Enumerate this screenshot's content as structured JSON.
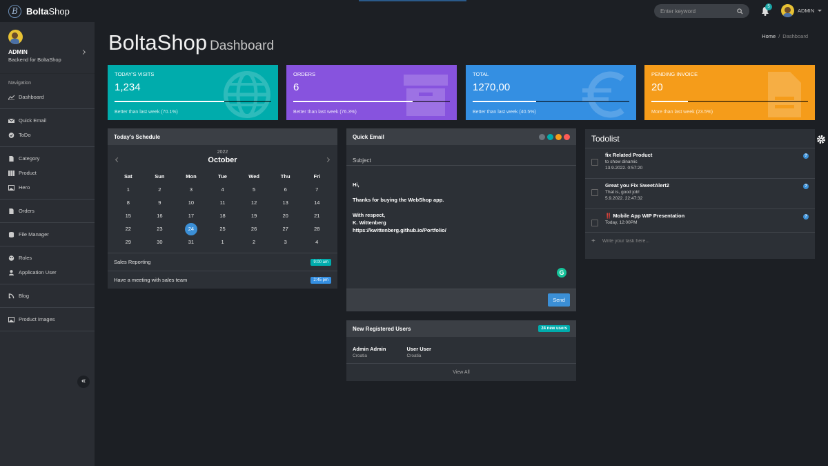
{
  "brand": {
    "name_bold": "Bolta",
    "name_rest": "Shop",
    "logo_letter": "B"
  },
  "search": {
    "placeholder": "Enter keyword"
  },
  "notifications": {
    "count": "5"
  },
  "user": {
    "name": "ADMIN"
  },
  "sidebar": {
    "profile": {
      "name": "ADMIN",
      "subtitle": "Backend for BoltaShop"
    },
    "section_label": "Navigation",
    "items": [
      {
        "label": "Dashboard",
        "icon": "chart-icon"
      },
      {
        "label": "Quick Email",
        "icon": "envelope-icon"
      },
      {
        "label": "ToDo",
        "icon": "check-circle-icon"
      },
      {
        "label": "Category",
        "icon": "file-icon"
      },
      {
        "label": "Product",
        "icon": "columns-icon"
      },
      {
        "label": "Hero",
        "icon": "image-icon"
      },
      {
        "label": "Orders",
        "icon": "file-icon"
      },
      {
        "label": "File Manager",
        "icon": "database-icon"
      },
      {
        "label": "Roles",
        "icon": "roles-icon"
      },
      {
        "label": "Application User",
        "icon": "user-icon"
      },
      {
        "label": "Blog",
        "icon": "blog-icon"
      },
      {
        "label": "Product Images",
        "icon": "image-icon"
      }
    ]
  },
  "page": {
    "title": "BoltaShop",
    "subtitle": "Dashboard"
  },
  "breadcrumb": {
    "home": "Home",
    "separator": "/",
    "current": "Dashboard"
  },
  "stats": [
    {
      "label": "TODAY'S VISITS",
      "value": "1,234",
      "desc": "Better than last week (70.1%)",
      "progress": 70.1,
      "color": "#00acac",
      "icon": "globe-icon"
    },
    {
      "label": "ORDERS",
      "value": "6",
      "desc": "Better than last week (76.3%)",
      "progress": 76.3,
      "color": "#8753de",
      "icon": "archive-icon"
    },
    {
      "label": "TOTAL",
      "value": "1270,00",
      "desc": "Better than last week (40.5%)",
      "progress": 40.5,
      "color": "#348fe2",
      "icon": "euro-icon"
    },
    {
      "label": "PENDING INVOICE",
      "value": "20",
      "desc": "More than last week (23.5%)",
      "progress": 23.5,
      "color": "#f59c1a",
      "icon": "invoice-icon"
    }
  ],
  "schedule": {
    "title": "Today's Schedule",
    "year": "2022",
    "month": "October",
    "weekdays": [
      "Sat",
      "Sun",
      "Mon",
      "Tue",
      "Wed",
      "Thu",
      "Fri"
    ],
    "weeks": [
      [
        "1",
        "2",
        "3",
        "4",
        "5",
        "6",
        "7"
      ],
      [
        "8",
        "9",
        "10",
        "11",
        "12",
        "13",
        "14"
      ],
      [
        "15",
        "16",
        "17",
        "18",
        "19",
        "20",
        "21"
      ],
      [
        "22",
        "23",
        "24",
        "25",
        "26",
        "27",
        "28"
      ],
      [
        "29",
        "30",
        "31",
        "1",
        "2",
        "3",
        "4"
      ]
    ],
    "today": "24",
    "events": [
      {
        "title": "Sales Reporting",
        "time": "9:00 am",
        "color": "#00acac"
      },
      {
        "title": "Have a meeting with sales team",
        "time": "2:45 pm",
        "color": "#348fe2"
      }
    ]
  },
  "quick_email": {
    "title": "Quick Email",
    "subject_placeholder": "Subject",
    "body": {
      "greeting": "Hi,",
      "line1": "Thanks for buying the WebShop app.",
      "closing": "With respect,",
      "name": "K. Wittenberg",
      "link": "https://kwittenberg.github.io/Portfolio/"
    },
    "send_label": "Send",
    "grammarly": "G"
  },
  "new_users": {
    "title": "New Registered Users",
    "badge": "24 new users",
    "users": [
      {
        "name": "Admin Admin",
        "country": "Croatia"
      },
      {
        "name": "User User",
        "country": "Croatia"
      }
    ],
    "view_all": "View All"
  },
  "todolist": {
    "title": "Todolist",
    "items": [
      {
        "title": "fix Related Product",
        "subtitle": "to show dinamic",
        "date": "13.9.2022. 0:57:20"
      },
      {
        "title": "Great you Fix SweetAlert2",
        "subtitle": "That is, good job!",
        "date": "5.9.2022. 22:47:32"
      },
      {
        "title": "‼️ Mobile App WIP Presentation",
        "subtitle": "",
        "date": "Today, 12:00PM"
      }
    ],
    "add_placeholder": "Write your task here..."
  }
}
